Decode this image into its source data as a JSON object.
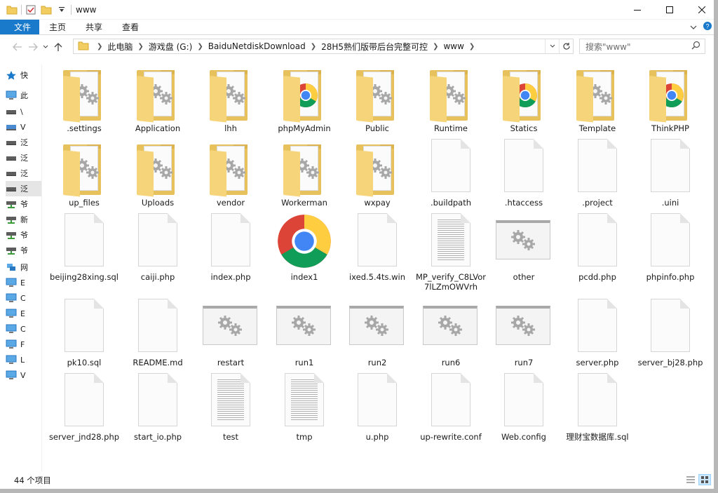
{
  "window": {
    "title": "www"
  },
  "ribbon": {
    "tabs": [
      "文件",
      "主页",
      "共享",
      "查看"
    ]
  },
  "address": {
    "crumbs": [
      "此电脑",
      "游戏盘 (G:)",
      "BaiduNetdiskDownload",
      "28H5熟们版带后台完整可控",
      "www"
    ]
  },
  "search": {
    "placeholder": "搜索\"www\""
  },
  "sidebar": {
    "items": [
      "快",
      "此",
      "\\",
      "V",
      "泛",
      "泛",
      "泛",
      "泛",
      "爷",
      "新",
      "爷",
      "爷",
      "网",
      "E",
      "C",
      "E",
      "C",
      "F",
      "L",
      "V"
    ]
  },
  "files": [
    {
      "name": ".settings",
      "kind": "folder"
    },
    {
      "name": "Application",
      "kind": "folder"
    },
    {
      "name": "lhh",
      "kind": "folder"
    },
    {
      "name": "phpMyAdmin",
      "kind": "folder"
    },
    {
      "name": "Public",
      "kind": "folder"
    },
    {
      "name": "Runtime",
      "kind": "folder"
    },
    {
      "name": "Statics",
      "kind": "folder"
    },
    {
      "name": "Template",
      "kind": "folder"
    },
    {
      "name": "ThinkPHP",
      "kind": "folder"
    },
    {
      "name": "up_files",
      "kind": "folder"
    },
    {
      "name": "Uploads",
      "kind": "folder"
    },
    {
      "name": "vendor",
      "kind": "folder"
    },
    {
      "name": "Workerman",
      "kind": "folder"
    },
    {
      "name": "wxpay",
      "kind": "folder"
    },
    {
      "name": ".buildpath",
      "kind": "file"
    },
    {
      "name": ".htaccess",
      "kind": "file"
    },
    {
      "name": ".project",
      "kind": "file"
    },
    {
      "name": ".uini",
      "kind": "file"
    },
    {
      "name": "beijing28xing.sql",
      "kind": "file"
    },
    {
      "name": "caiji.php",
      "kind": "file"
    },
    {
      "name": "index.php",
      "kind": "file"
    },
    {
      "name": "index1",
      "kind": "chrome"
    },
    {
      "name": "ixed.5.4ts.win",
      "kind": "file"
    },
    {
      "name": "MP_verify_C8LVor7lLZmOWVrh",
      "kind": "text"
    },
    {
      "name": "other",
      "kind": "exe"
    },
    {
      "name": "pcdd.php",
      "kind": "file"
    },
    {
      "name": "phpinfo.php",
      "kind": "file"
    },
    {
      "name": "pk10.sql",
      "kind": "file"
    },
    {
      "name": "README.md",
      "kind": "file"
    },
    {
      "name": "restart",
      "kind": "exe"
    },
    {
      "name": "run1",
      "kind": "exe"
    },
    {
      "name": "run2",
      "kind": "exe"
    },
    {
      "name": "run6",
      "kind": "exe"
    },
    {
      "name": "run7",
      "kind": "exe"
    },
    {
      "name": "server.php",
      "kind": "file"
    },
    {
      "name": "server_bj28.php",
      "kind": "file"
    },
    {
      "name": "server_jnd28.php",
      "kind": "file"
    },
    {
      "name": "start_io.php",
      "kind": "file"
    },
    {
      "name": "test",
      "kind": "text"
    },
    {
      "name": "tmp",
      "kind": "text"
    },
    {
      "name": "u.php",
      "kind": "file"
    },
    {
      "name": "up-rewrite.conf",
      "kind": "file"
    },
    {
      "name": "Web.config",
      "kind": "file"
    },
    {
      "name": "理财宝数据库.sql",
      "kind": "file"
    }
  ],
  "status": {
    "count": "44 个项目"
  }
}
